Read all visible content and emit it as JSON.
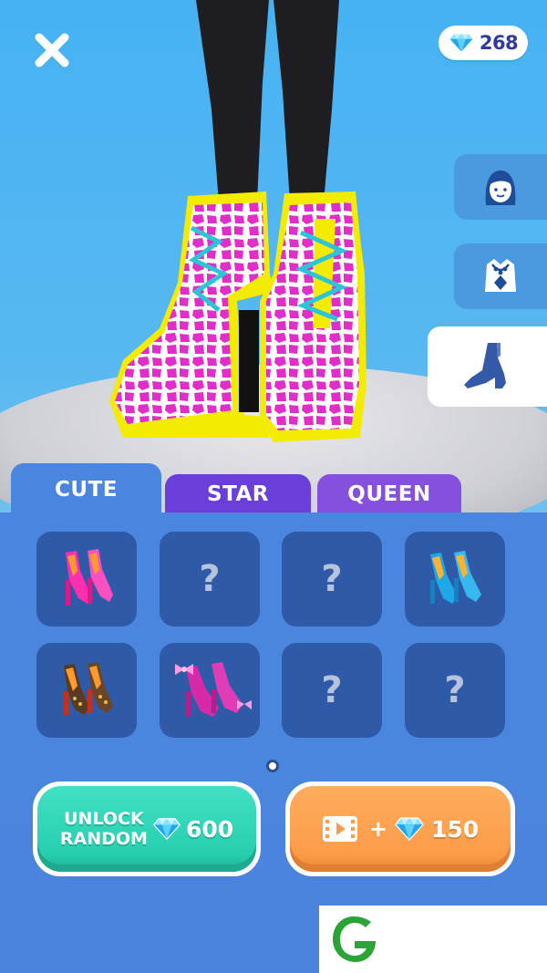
{
  "header": {
    "close_icon": "close-icon",
    "gem_count": "268",
    "gem_icon": "diamond-icon"
  },
  "side_categories": [
    {
      "name": "hair",
      "icon": "face-hair-icon",
      "active": false
    },
    {
      "name": "outfit",
      "icon": "top-outfit-icon",
      "active": false
    },
    {
      "name": "shoes",
      "icon": "high-heel-icon",
      "active": true
    }
  ],
  "tabs": [
    {
      "label": "CUTE",
      "active": true
    },
    {
      "label": "STAR",
      "active": false
    },
    {
      "label": "QUEEN",
      "active": false
    }
  ],
  "grid": {
    "locked_label": "?",
    "items": [
      {
        "type": "pink-heels",
        "locked": false
      },
      {
        "type": "locked",
        "locked": true
      },
      {
        "type": "locked",
        "locked": true
      },
      {
        "type": "blue-peep-toe-heels",
        "locked": false
      },
      {
        "type": "studded-brown-heels",
        "locked": false
      },
      {
        "type": "magenta-bow-heels",
        "locked": false
      },
      {
        "type": "locked",
        "locked": true
      },
      {
        "type": "locked",
        "locked": true
      }
    ]
  },
  "pager": {
    "pages": 1,
    "current": 1
  },
  "buttons": {
    "unlock_line1": "UNLOCK",
    "unlock_line2": "RANDOM",
    "unlock_price": "600",
    "ad_plus": "+",
    "ad_reward": "150"
  },
  "colors": {
    "sky": "#46b2f3",
    "panel": "#4a86df",
    "slot": "#2f5aa8",
    "tab_star": "#6a3ed9",
    "tab_queen": "#8450dd",
    "unlock_green": "#27cfb0",
    "ad_orange": "#fb9c48",
    "gem_text": "#323b9b"
  }
}
